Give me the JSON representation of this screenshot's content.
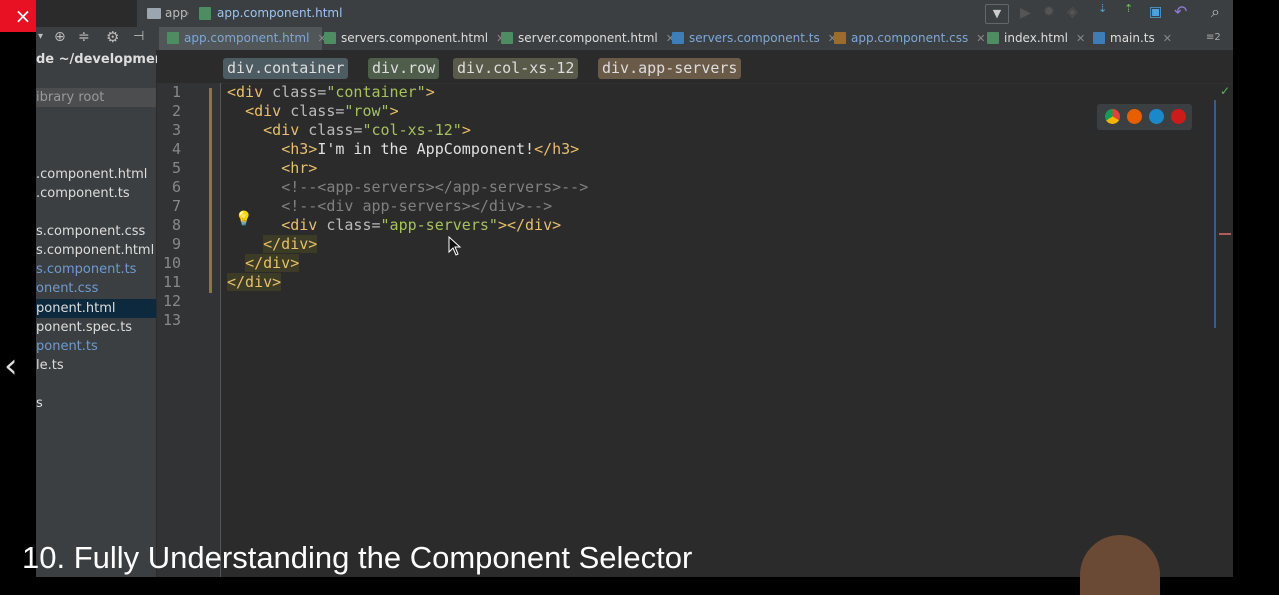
{
  "window": {
    "close_icon": "×",
    "restore_icon": "❐",
    "minimize_icon": "—"
  },
  "navbar": {
    "crumbs": [
      "app",
      "app.component.html"
    ]
  },
  "tabs": [
    {
      "label": "app.component.html",
      "active": true
    },
    {
      "label": "servers.component.html"
    },
    {
      "label": "server.component.html"
    },
    {
      "label": "servers.component.ts"
    },
    {
      "label": "app.component.css"
    },
    {
      "label": "index.html"
    },
    {
      "label": "main.ts"
    }
  ],
  "tabs_overflow": "≡2",
  "project": {
    "header": "de ~/development/",
    "root_label": "ibrary root",
    "items": [
      ".component.html",
      ".component.ts",
      "s.component.css",
      "s.component.html",
      "s.component.ts",
      "onent.css",
      "ponent.html",
      "ponent.spec.ts",
      "ponent.ts",
      "le.ts",
      "s"
    ]
  },
  "editor": {
    "breadcrumbs": [
      "div.container",
      "div.row",
      "div.col-xs-12",
      "div.app-servers"
    ],
    "line_numbers": [
      "1",
      "2",
      "3",
      "4",
      "5",
      "6",
      "7",
      "8",
      "9",
      "10",
      "11",
      "12",
      "13"
    ]
  },
  "subtitle": "10. Fully Understanding the Component Selector"
}
